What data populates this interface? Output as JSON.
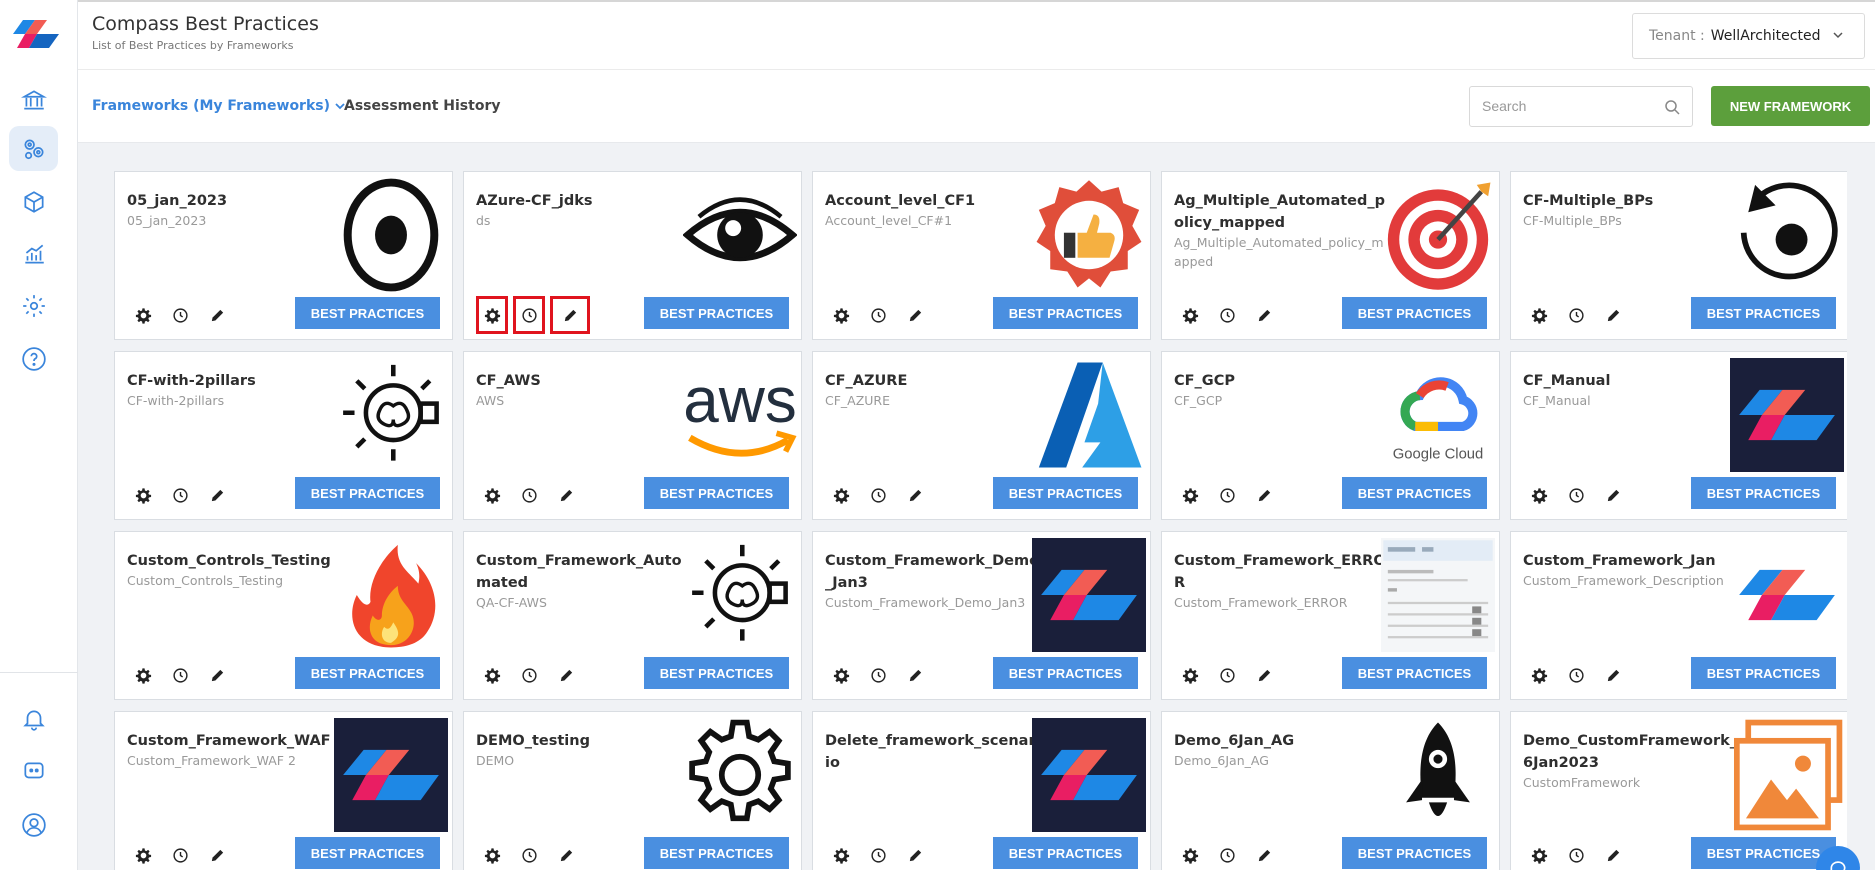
{
  "header": {
    "title": "Compass Best Practices",
    "subtitle": "List of Best Practices by Frameworks",
    "tenant_label": "Tenant :",
    "tenant_value": "WellArchitected"
  },
  "toolbar": {
    "frameworks_tab": "Frameworks (My Frameworks)",
    "history_tab": "Assessment History",
    "search_placeholder": "Search",
    "new_button": "NEW FRAMEWORK"
  },
  "best_practices_label": "BEST PRACTICES",
  "colors": {
    "accent": "#3a85db",
    "primary_button": "#4a8fe0",
    "success_button": "#5c9f3c",
    "highlight": "#e0141e"
  },
  "sidebar_icons": [
    "logo-icon",
    "bank-icon",
    "gears-icon",
    "cube-icon",
    "chart-icon",
    "gear-icon",
    "help-icon",
    "bell-icon",
    "chat-icon",
    "user-icon"
  ],
  "cards": [
    {
      "title": "05_jan_2023",
      "desc": "05_jan_2023",
      "icon": "target-ring-icon"
    },
    {
      "title": "AZure-CF_jdks",
      "desc": "ds",
      "icon": "eye-icon"
    },
    {
      "title": "Account_level_CF1",
      "desc": "Account_level_CF#1",
      "icon": "thumbs-up-badge-icon"
    },
    {
      "title": "Ag_Multiple_Automated_policy_mapped",
      "desc": "Ag_Multiple_Automated_policy_mapped",
      "icon": "dartboard-icon"
    },
    {
      "title": "CF-Multiple_BPs",
      "desc": "CF-Multiple_BPs",
      "icon": "refresh-circle-icon"
    },
    {
      "title": "CF-with-2pillars",
      "desc": "CF-with-2pillars",
      "icon": "idea-bulb-icon"
    },
    {
      "title": "CF_AWS",
      "desc": "AWS",
      "icon": "aws-logo-icon",
      "logo_text": "aws"
    },
    {
      "title": "CF_AZURE",
      "desc": "CF_AZURE",
      "icon": "azure-logo-icon"
    },
    {
      "title": "CF_GCP",
      "desc": "CF_GCP",
      "icon": "google-cloud-logo-icon",
      "logo_text": "Google Cloud"
    },
    {
      "title": "CF_Manual",
      "desc": "CF_Manual",
      "icon": "compass-logo-dark-icon"
    },
    {
      "title": "Custom_Controls_Testing",
      "desc": "Custom_Controls_Testing",
      "icon": "flame-icon"
    },
    {
      "title": "Custom_Framework_Automated",
      "desc": "QA-CF-AWS",
      "icon": "idea-bulb-icon"
    },
    {
      "title": "Custom_Framework_Demo_Jan3",
      "desc": "Custom_Framework_Demo_Jan3",
      "icon": "compass-logo-dark-icon"
    },
    {
      "title": "Custom_Framework_ERROR",
      "desc": "Custom_Framework_ERROR",
      "icon": "document-preview-icon"
    },
    {
      "title": "Custom_Framework_Jan",
      "desc": "Custom_Framework_Description",
      "icon": "compass-logo-icon"
    },
    {
      "title": "Custom_Framework_WAF",
      "desc": "Custom_Framework_WAF 2",
      "icon": "compass-logo-dark-icon"
    },
    {
      "title": "DEMO_testing",
      "desc": "DEMO",
      "icon": "cog-icon"
    },
    {
      "title": "Delete_framework_scenario",
      "desc": "",
      "icon": "compass-logo-dark-icon"
    },
    {
      "title": "Demo_6Jan_AG",
      "desc": "Demo_6Jan_AG",
      "icon": "rocket-icon"
    },
    {
      "title": "Demo_CustomFramework_6Jan2023",
      "desc": "CustomFramework",
      "icon": "image-gallery-icon"
    }
  ]
}
